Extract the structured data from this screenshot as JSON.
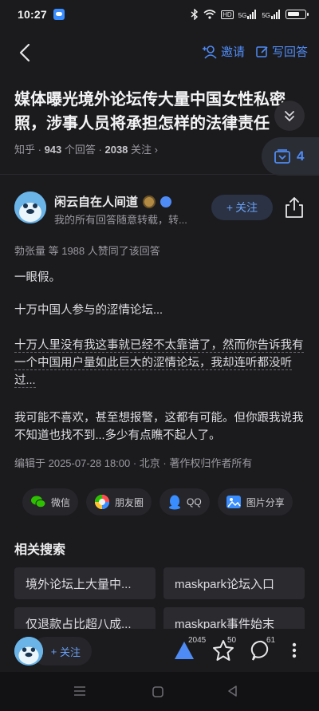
{
  "status_bar": {
    "time": "10:27",
    "network": "HD",
    "signal_1": "5G",
    "signal_2": "5G"
  },
  "nav": {
    "invite_label": "邀请",
    "write_answer_label": "写回答"
  },
  "question": {
    "title_line1": "媒体曝光境外论坛传大量中国女性私密",
    "title_line2": "照，涉事人员将承担怎样的法律责任",
    "source": "知乎",
    "answer_count": "943",
    "answer_label": "个回答",
    "follow_count": "2038",
    "follow_label": "关注",
    "collection_count": "4"
  },
  "author": {
    "name": "闲云自在人间道",
    "bio": "我的所有回答随意转载，转...",
    "follow_label": "关注"
  },
  "answer": {
    "likers_text": "勃张量  等  1988  人赞同了该回答",
    "p1": "一眼假。",
    "p2": "十万中国人参与的涩情论坛...",
    "p3": "十万人里没有我这事就已经不太靠谱了，然而你告诉我有一个中国用户量如此巨大的涩情论坛，我却连听都没听过...",
    "p4": "我可能不喜欢，甚至想报警，这都有可能。但你跟我说我不知道也找不到...多少有点瞧不起人了。",
    "edit_meta": "编辑于  2025-07-28  18:00 · 北京 · 著作权归作者所有"
  },
  "share": {
    "wechat": "微信",
    "moments": "朋友圈",
    "qq": "QQ",
    "image_share": "图片分享"
  },
  "related": {
    "title": "相关搜索",
    "items": [
      "境外论坛上大量中...",
      "maskpark论坛入口",
      "仅退款占比超八成...",
      "maskpark事件始末"
    ]
  },
  "bottom_bar": {
    "follow_label": "关注",
    "upvotes": "2045",
    "favorites": "50",
    "comments": "61"
  },
  "colors": {
    "background": "#1b1b1e",
    "accent": "#4f8bf4",
    "muted": "#9a9aa0",
    "card": "#2a2a2f"
  }
}
